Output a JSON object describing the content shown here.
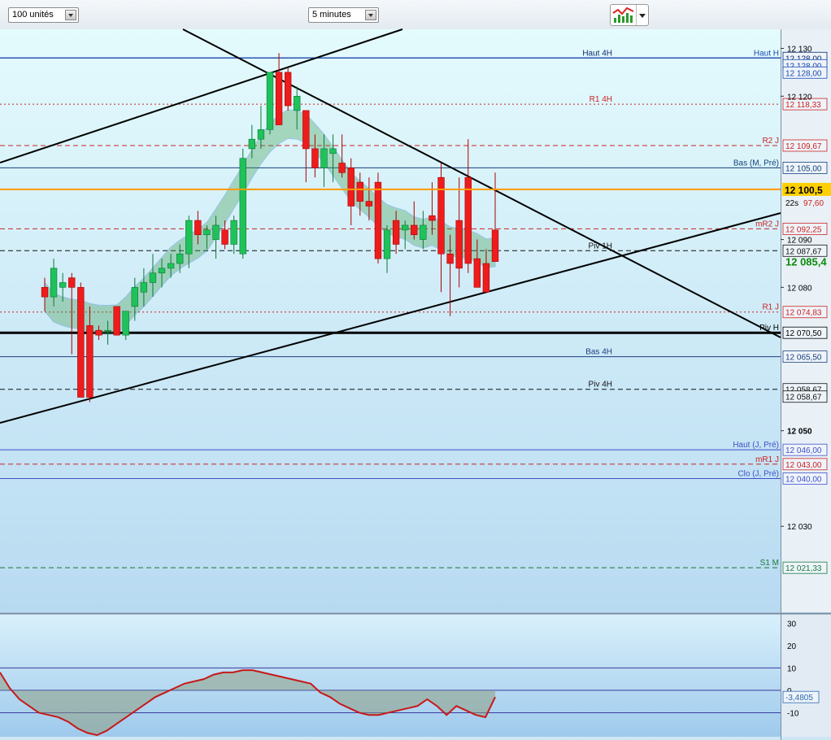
{
  "toolbar": {
    "units_select": "100 unités",
    "interval_select": "5 minutes",
    "chart_tools_icon": "chart-tools-icon"
  },
  "colors": {
    "bull": "#1fc25a",
    "bear": "#ee1c1c",
    "cloud_bull": "#3f9e4e",
    "cloud_bear": "#a8808a",
    "current_price_bg": "#ffd000",
    "last_price_text": "#0a8a0a"
  },
  "chart_data": {
    "type": "candlestick",
    "instrument_note": "",
    "ylim": [
      12012,
      12134
    ],
    "y_ticks": [
      {
        "value": 12130,
        "label": "12 130"
      },
      {
        "value": 12120,
        "label": "12 120"
      },
      {
        "value": 12090,
        "label": "12 090"
      },
      {
        "value": 12080,
        "label": "12 080"
      },
      {
        "value": 12050,
        "label": "12 050"
      },
      {
        "value": 12030,
        "label": "12 030"
      }
    ],
    "current_price": {
      "label": "12 100,5",
      "value": 12100.5
    },
    "countdown": {
      "text": "22s",
      "extra": "97,60"
    },
    "last_price": {
      "label": "12 085,4",
      "value": 12085.4
    },
    "candles": [
      {
        "o": 12080,
        "h": 12082,
        "l": 12075,
        "c": 12078
      },
      {
        "o": 12078,
        "h": 12086,
        "l": 12076,
        "c": 12084
      },
      {
        "o": 12080,
        "h": 12083,
        "l": 12077,
        "c": 12081
      },
      {
        "o": 12082,
        "h": 12083,
        "l": 12066,
        "c": 12080
      },
      {
        "o": 12080,
        "h": 12081,
        "l": 12058,
        "c": 12057
      },
      {
        "o": 12072,
        "h": 12076,
        "l": 12056,
        "c": 12057
      },
      {
        "o": 12071,
        "h": 12072,
        "l": 12069,
        "c": 12070
      },
      {
        "o": 12071,
        "h": 12073,
        "l": 12068,
        "c": 12071
      },
      {
        "o": 12076,
        "h": 12076,
        "l": 12070,
        "c": 12070
      },
      {
        "o": 12070,
        "h": 12075,
        "l": 12069,
        "c": 12075
      },
      {
        "o": 12076,
        "h": 12082,
        "l": 12073,
        "c": 12080
      },
      {
        "o": 12079,
        "h": 12084,
        "l": 12076,
        "c": 12081
      },
      {
        "o": 12081,
        "h": 12087,
        "l": 12078,
        "c": 12083
      },
      {
        "o": 12083,
        "h": 12086,
        "l": 12080,
        "c": 12084
      },
      {
        "o": 12084,
        "h": 12087,
        "l": 12082,
        "c": 12085
      },
      {
        "o": 12085,
        "h": 12089,
        "l": 12083,
        "c": 12087
      },
      {
        "o": 12087,
        "h": 12095,
        "l": 12084,
        "c": 12094
      },
      {
        "o": 12094,
        "h": 12096,
        "l": 12089,
        "c": 12091
      },
      {
        "o": 12091,
        "h": 12093,
        "l": 12088,
        "c": 12092
      },
      {
        "o": 12090,
        "h": 12095,
        "l": 12086,
        "c": 12093
      },
      {
        "o": 12092,
        "h": 12094,
        "l": 12088,
        "c": 12089
      },
      {
        "o": 12089,
        "h": 12095,
        "l": 12087,
        "c": 12094
      },
      {
        "o": 12087,
        "h": 12109,
        "l": 12086,
        "c": 12107
      },
      {
        "o": 12109,
        "h": 12114,
        "l": 12107,
        "c": 12111
      },
      {
        "o": 12111,
        "h": 12118,
        "l": 12109,
        "c": 12113
      },
      {
        "o": 12113,
        "h": 12125,
        "l": 12112,
        "c": 12125
      },
      {
        "o": 12125,
        "h": 12129,
        "l": 12114,
        "c": 12114
      },
      {
        "o": 12125,
        "h": 12126,
        "l": 12117,
        "c": 12118
      },
      {
        "o": 12117,
        "h": 12122,
        "l": 12113,
        "c": 12120
      },
      {
        "o": 12117,
        "h": 12116,
        "l": 12102,
        "c": 12109
      },
      {
        "o": 12109,
        "h": 12112,
        "l": 12103,
        "c": 12105
      },
      {
        "o": 12105,
        "h": 12112,
        "l": 12101,
        "c": 12109
      },
      {
        "o": 12108,
        "h": 12112,
        "l": 12102,
        "c": 12109
      },
      {
        "o": 12106,
        "h": 12112,
        "l": 12103,
        "c": 12104
      },
      {
        "o": 12105,
        "h": 12107,
        "l": 12093,
        "c": 12097
      },
      {
        "o": 12102,
        "h": 12104,
        "l": 12095,
        "c": 12098
      },
      {
        "o": 12098,
        "h": 12103,
        "l": 12094,
        "c": 12097
      },
      {
        "o": 12102,
        "h": 12104,
        "l": 12085,
        "c": 12086
      },
      {
        "o": 12086,
        "h": 12093,
        "l": 12083,
        "c": 12092
      },
      {
        "o": 12094,
        "h": 12096,
        "l": 12087,
        "c": 12089
      },
      {
        "o": 12092,
        "h": 12094,
        "l": 12088,
        "c": 12093
      },
      {
        "o": 12093,
        "h": 12098,
        "l": 12090,
        "c": 12091
      },
      {
        "o": 12090,
        "h": 12096,
        "l": 12088,
        "c": 12093
      },
      {
        "o": 12095,
        "h": 12102,
        "l": 12091,
        "c": 12094
      },
      {
        "o": 12103,
        "h": 12106,
        "l": 12079,
        "c": 12087
      },
      {
        "o": 12087,
        "h": 12091,
        "l": 12074,
        "c": 12085
      },
      {
        "o": 12094,
        "h": 12103,
        "l": 12080,
        "c": 12084
      },
      {
        "o": 12103,
        "h": 12111,
        "l": 12083,
        "c": 12085
      },
      {
        "o": 12086,
        "h": 12090,
        "l": 12080,
        "c": 12080
      },
      {
        "o": 12085,
        "h": 12088,
        "l": 12079,
        "c": 12079
      },
      {
        "o": 12092,
        "h": 12104,
        "l": 12086,
        "c": 12085.4
      }
    ],
    "horizontal_levels": [
      {
        "name": "Haut 4H",
        "value": 12128.0,
        "label": "12 128,00",
        "color": "#0a2a6e",
        "style": "solid",
        "tag": "Haut 4H"
      },
      {
        "name": "Haut H",
        "value": 12128.0,
        "label": "12 128,00",
        "color": "#1a4ab0",
        "style": "solid",
        "tag": "Haut H"
      },
      {
        "name": "Haut H2",
        "value": 12128.0,
        "label": "12 128,00",
        "color": "#1a4ab0",
        "style": "solid",
        "tag": ""
      },
      {
        "name": "R1 4H",
        "value": 12118.33,
        "label": "12 118,33",
        "color": "#cc2222",
        "style": "dotted",
        "tag": "R1 4H"
      },
      {
        "name": "R2 J",
        "value": 12109.67,
        "label": "12 109,67",
        "color": "#cc2222",
        "style": "dashed",
        "tag": "R2 J"
      },
      {
        "name": "Bas (M, Pré)",
        "value": 12105.0,
        "label": "12 105,00",
        "color": "#14407a",
        "style": "solid",
        "tag": "Bas (M, Pré)"
      },
      {
        "name": "mR2 J",
        "value": 12092.25,
        "label": "12 092,25",
        "color": "#cc2222",
        "style": "dashed",
        "tag": "mR2 J"
      },
      {
        "name": "Piv 1H",
        "value": 12087.67,
        "label": "12 087,67",
        "color": "#111111",
        "style": "dashed",
        "tag": "Piv 1H"
      },
      {
        "name": "R1 J",
        "value": 12074.83,
        "label": "12 074,83",
        "color": "#cc2222",
        "style": "dotted",
        "tag": "R1 J"
      },
      {
        "name": "Piv H",
        "value": 12070.5,
        "label": "12 070,50",
        "color": "#000000",
        "style": "solid",
        "tag": "Piv H"
      },
      {
        "name": "Bas 4H",
        "value": 12065.5,
        "label": "12 065,50",
        "color": "#1d3f7d",
        "style": "solid",
        "tag": "Bas 4H"
      },
      {
        "name": "Piv 4H",
        "value": 12058.67,
        "label": "12 058,67",
        "color": "#111111",
        "style": "dashed",
        "tag": "Piv 4H"
      },
      {
        "name": "Piv 4H b",
        "value": 12058.67,
        "label": "12 058,67",
        "color": "#111111",
        "style": "none",
        "tag": ""
      },
      {
        "name": "Haut (J, Pré)",
        "value": 12046.0,
        "label": "12 046,00",
        "color": "#4050c8",
        "style": "solid",
        "tag": "Haut (J, Pré)"
      },
      {
        "name": "mR1 J",
        "value": 12043.0,
        "label": "12 043,00",
        "color": "#cc2222",
        "style": "dashed",
        "tag": "mR1 J"
      },
      {
        "name": "Clo (J, Pré)",
        "value": 12040.0,
        "label": "12 040,00",
        "color": "#4050c8",
        "style": "solid",
        "tag": "Clo (J, Pré)"
      },
      {
        "name": "S1 M",
        "value": 12021.33,
        "label": "12 021,33",
        "color": "#1a7a3a",
        "style": "dashed",
        "tag": "S1 M"
      }
    ],
    "oscillator": {
      "ylim": [
        -20,
        33
      ],
      "ticks": [
        {
          "value": 30,
          "label": "30"
        },
        {
          "value": 20,
          "label": "20"
        },
        {
          "value": 10,
          "label": "10"
        },
        {
          "value": 0,
          "label": "0"
        },
        {
          "value": -10,
          "label": "-10"
        }
      ],
      "last_value_label": "-3,4805",
      "values": [
        8,
        1,
        -4,
        -7,
        -10,
        -11,
        -12,
        -14,
        -17,
        -19,
        -20,
        -18,
        -15,
        -12,
        -9,
        -6,
        -3,
        -1,
        1,
        3,
        4,
        5,
        7,
        8,
        8,
        9,
        9,
        8,
        7,
        6,
        5,
        4,
        3,
        -1,
        -3,
        -6,
        -8,
        -10,
        -11,
        -11,
        -10,
        -9,
        -8,
        -7,
        -4,
        -7,
        -11,
        -7,
        -9,
        -11,
        -12,
        -3
      ]
    }
  }
}
